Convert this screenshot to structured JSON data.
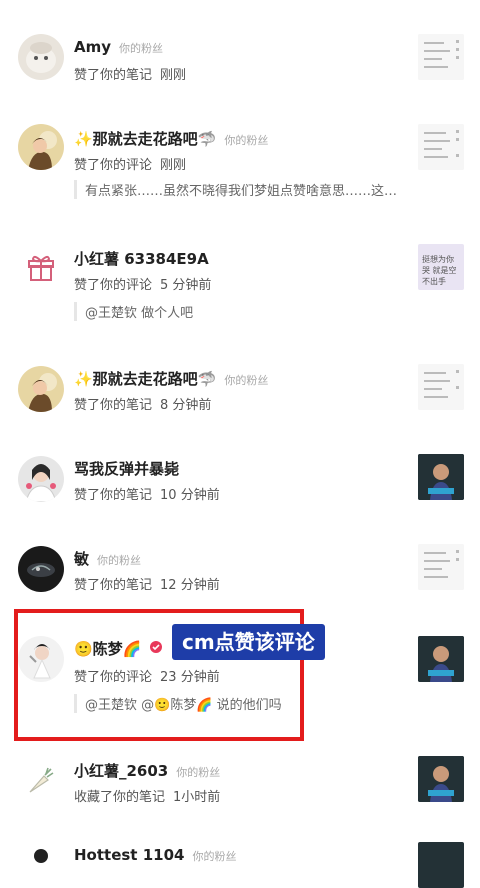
{
  "rows": [
    {
      "name": "Amy",
      "fan": "你的粉丝",
      "action": "赞了你的笔记",
      "time": "刚刚",
      "quote": ""
    },
    {
      "name": "✨那就去走花路吧🦈",
      "fan": "你的粉丝",
      "action": "赞了你的评论",
      "time": "刚刚",
      "quote": "有点紧张……虽然不晓得我们梦姐点赞啥意思……这…"
    },
    {
      "name": "小红薯 63384E9A",
      "fan": "",
      "action": "赞了你的评论",
      "time": "5 分钟前",
      "quote": "@王楚钦 做个人吧",
      "thumb_text": "挺想为你哭 就是空不出手"
    },
    {
      "name": "✨那就去走花路吧🦈",
      "fan": "你的粉丝",
      "action": "赞了你的笔记",
      "time": "8 分钟前",
      "quote": ""
    },
    {
      "name": "骂我反弹并暴毙",
      "fan": "",
      "action": "赞了你的笔记",
      "time": "10 分钟前",
      "quote": ""
    },
    {
      "name": "敏",
      "fan": "你的粉丝",
      "action": "赞了你的笔记",
      "time": "12 分钟前",
      "quote": ""
    },
    {
      "name": "🙂陈梦🌈",
      "fan": "",
      "action": "赞了你的评论",
      "time": "23 分钟前",
      "quote": "@王楚钦 @🙂陈梦🌈 说的他们吗"
    },
    {
      "name": "小红薯_2603",
      "fan": "你的粉丝",
      "action": "收藏了你的笔记",
      "time": "1小时前",
      "quote": ""
    },
    {
      "name": "Hottest 1104",
      "fan": "你的粉丝",
      "action": "",
      "time": "",
      "quote": ""
    }
  ],
  "callout": "cm点赞该评论",
  "colors": {
    "highlight": "#e31c1c",
    "callout_bg": "#1e3da8"
  }
}
